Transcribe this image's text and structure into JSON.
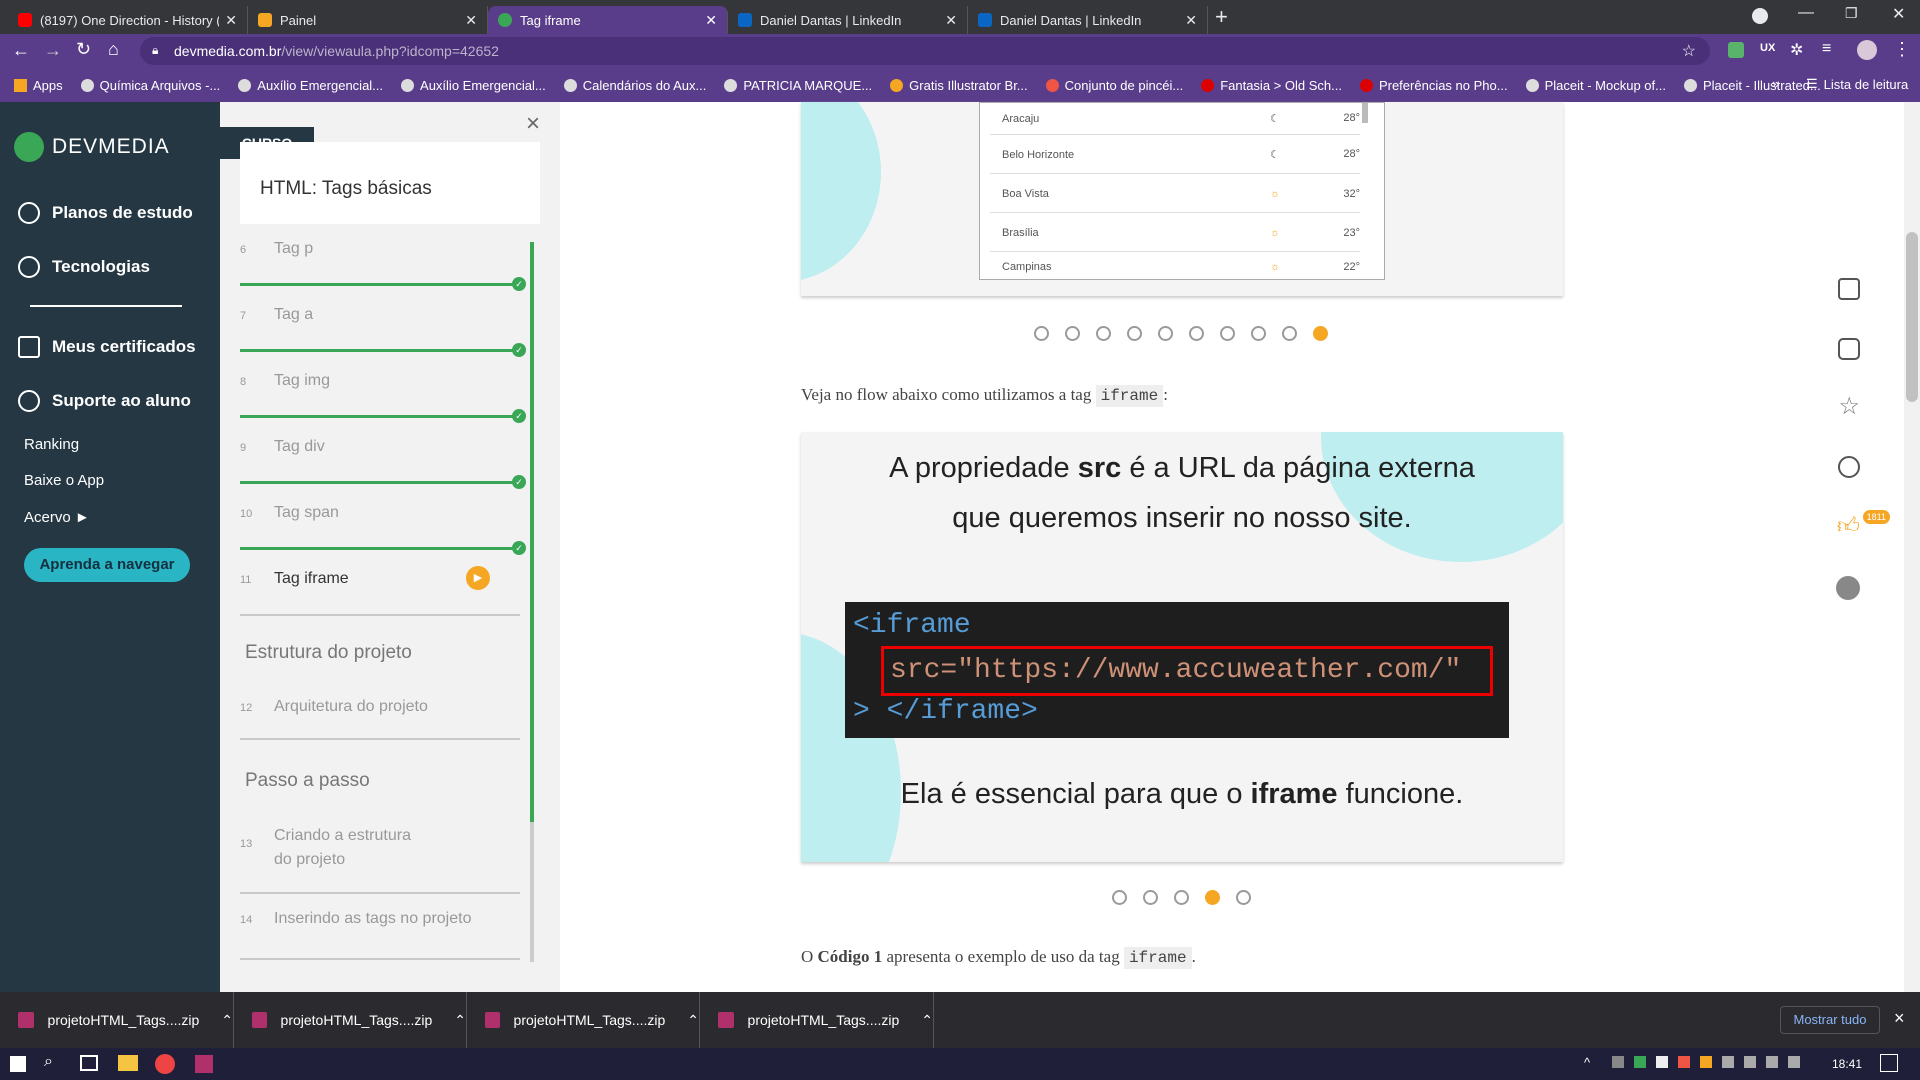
{
  "browser": {
    "tabs": [
      {
        "title": "(8197) One Direction - History (O",
        "favicon_color": "#ff0000"
      },
      {
        "title": "Painel",
        "favicon_color": "#f5a623"
      },
      {
        "title": "Tag iframe",
        "favicon_color": "#3aa757"
      },
      {
        "title": "Daniel Dantas | LinkedIn",
        "favicon_color": "#0a66c2"
      },
      {
        "title": "Daniel Dantas | LinkedIn",
        "favicon_color": "#0a66c2"
      }
    ],
    "new_tab": "+",
    "url_host": "devmedia.com.br",
    "url_path": "/view/viewaula.php?idcomp=42652",
    "bookmarks": [
      "Apps",
      "Química Arquivos -...",
      "Auxílio Emergencial...",
      "Auxílio Emergencial...",
      "Calendários do Aux...",
      "PATRICIA MARQUE...",
      "Gratis Illustrator Br...",
      "Conjunto de pincéi...",
      "Fantasia > Old Sch...",
      "Preferências no Pho...",
      "Placeit - Mockup of...",
      "Placeit - Illustrated..."
    ],
    "bookmarks_more": "»",
    "reading_list": "Lista de leitura"
  },
  "sidebar": {
    "logo": "DEVMEDIA",
    "items": [
      "Planos de estudo",
      "Tecnologias",
      "Meus certificados",
      "Suporte ao aluno"
    ],
    "links": [
      "Ranking",
      "Baixe o App",
      "Acervo ►"
    ],
    "cta": "Aprenda a navegar"
  },
  "course": {
    "badge": "CURSO",
    "title": "HTML: Tags básicas",
    "lessons": [
      {
        "num": "6",
        "label": "Tag p",
        "done": true
      },
      {
        "num": "7",
        "label": "Tag a",
        "done": true
      },
      {
        "num": "8",
        "label": "Tag img",
        "done": true
      },
      {
        "num": "9",
        "label": "Tag div",
        "done": true
      },
      {
        "num": "10",
        "label": "Tag span",
        "done": true
      },
      {
        "num": "11",
        "label": "Tag iframe",
        "current": true
      }
    ],
    "section2": "Estrutura do projeto",
    "lesson12": {
      "num": "12",
      "label": "Arquitetura do projeto"
    },
    "section3": "Passo a passo",
    "lesson13": {
      "num": "13",
      "label": "Criando a estrutura do projeto"
    },
    "lesson14": {
      "num": "14",
      "label": "Inserindo as tags no projeto"
    },
    "close": "×"
  },
  "weather": {
    "rows": [
      {
        "city": "Aracaju",
        "temp": "28°"
      },
      {
        "city": "Belo Horizonte",
        "temp": "28°"
      },
      {
        "city": "Boa Vista",
        "temp": "32°"
      },
      {
        "city": "Brasília",
        "temp": "23°"
      },
      {
        "city": "Campinas",
        "temp": "22°"
      }
    ]
  },
  "content": {
    "intro_prefix": "Veja no flow abaixo como utilizamos a tag",
    "intro_code": "iframe",
    "intro_suffix": ":",
    "slide_line1a": "A propriedade ",
    "slide_line1b": "src",
    "slide_line1c": " é a URL da página externa",
    "slide_line2": "que queremos inserir no nosso site.",
    "code_open": "<iframe",
    "code_attr": "src=\"https://www.accuweather.com/\"",
    "code_close": "> </iframe>",
    "slide_line3a": "Ela é essencial para que o ",
    "slide_line3b": "iframe",
    "slide_line3c": " funcione.",
    "code_ref_prefix": "O ",
    "code_ref_bold": "Código 1",
    "code_ref_mid": " apresenta o exemplo de uso da tag ",
    "code_ref_code": "iframe",
    "code_ref_suffix": "."
  },
  "right_bar": {
    "likes": "1811"
  },
  "downloads": {
    "files": [
      "projetoHTML_Tags....zip",
      "projetoHTML_Tags....zip",
      "projetoHTML_Tags....zip",
      "projetoHTML_Tags....zip"
    ],
    "show_all": "Mostrar tudo",
    "close": "×"
  },
  "taskbar": {
    "time": "18:41"
  },
  "colors": {
    "accent": "#f5a623",
    "green": "#3aa757",
    "teal": "#2ab5c4",
    "nav": "#243743"
  }
}
